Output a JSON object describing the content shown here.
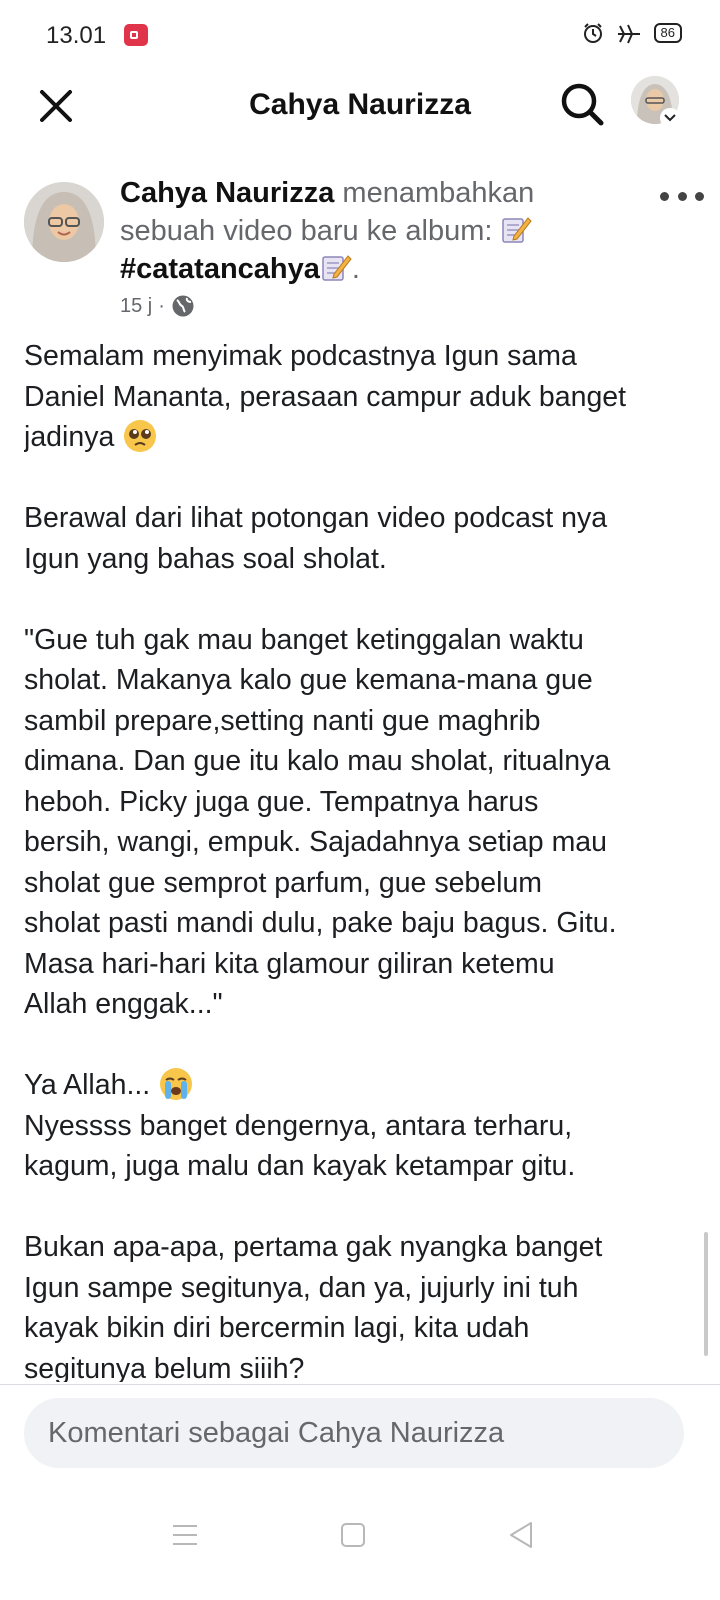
{
  "status_bar": {
    "time": "13.01",
    "battery": "86"
  },
  "header": {
    "title": "Cahya Naurizza"
  },
  "post": {
    "author": "Cahya Naurizza",
    "action": "menambahkan sebuah video baru ke album:",
    "album": "#catatancahya",
    "period": ".",
    "time": "15 j",
    "separator": "·",
    "paragraphs": [
      [
        "Semalam menyimak podcastnya Igun sama",
        "Daniel Mananta, perasaan campur aduk banget",
        "jadinya"
      ],
      [
        "Berawal dari lihat potongan video podcast nya",
        "Igun yang bahas soal sholat."
      ],
      [
        "\"Gue tuh gak mau banget ketinggalan waktu",
        "sholat. Makanya kalo gue kemana-mana gue",
        "sambil prepare,setting nanti gue maghrib",
        "dimana. Dan gue itu kalo mau sholat, ritualnya",
        "heboh. Picky juga gue. Tempatnya harus",
        "bersih, wangi, empuk. Sajadahnya setiap mau",
        "sholat gue semprot parfum, gue sebelum",
        "sholat pasti mandi dulu, pake baju bagus. Gitu.",
        "Masa hari-hari kita glamour giliran ketemu",
        "Allah  enggak...\""
      ],
      [
        "Ya Allah...",
        "Nyessss banget dengernya, antara terharu,",
        "kagum, juga malu dan kayak ketampar gitu."
      ],
      [
        "Bukan apa-apa, pertama gak nyangka banget",
        "Igun sampe segitunya, dan ya, jujurly ini tuh",
        "kayak  bikin diri bercermin lagi, kita udah",
        "segitunya belum siiih?"
      ]
    ]
  },
  "comment": {
    "placeholder": "Komentari sebagai Cahya Naurizza"
  },
  "icons": {
    "close": "close-icon",
    "search": "search-icon",
    "more": "more-icon",
    "globe": "globe-icon",
    "memo": "memo-emoji-icon",
    "pleading": "pleading-face-icon",
    "crying": "crying-face-icon",
    "menu": "menu-icon",
    "home": "home-icon",
    "back": "back-icon"
  },
  "colors": {
    "text": "#1c1e21",
    "secondary": "#65676b",
    "input_bg": "#f0f2f5"
  }
}
